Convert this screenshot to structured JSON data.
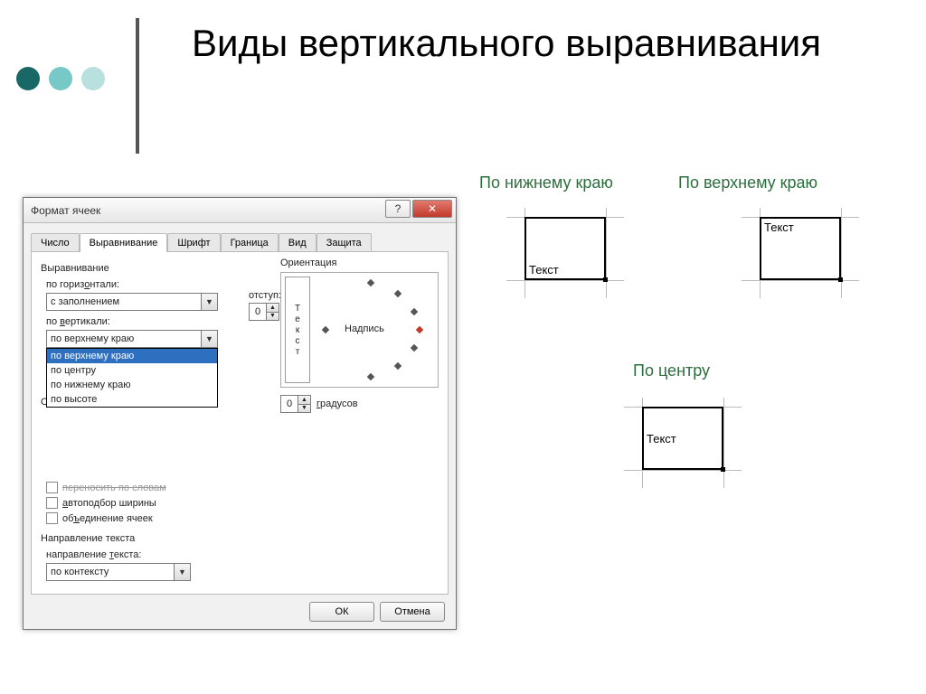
{
  "slide": {
    "title": "Виды вертикального выравнивания"
  },
  "dialog": {
    "title": "Формат ячеек",
    "help": "?",
    "close": "✕",
    "tabs": {
      "number": "Число",
      "alignment": "Выравнивание",
      "font": "Шрифт",
      "border": "Граница",
      "fill": "Вид",
      "protection": "Защита"
    },
    "align_group": "Выравнивание",
    "horiz_label": "по горизонтали:",
    "horiz_value": "с заполнением",
    "indent_label": "отступ:",
    "indent_value": "0",
    "vert_label": "по вертикали:",
    "vert_value": "по верхнему краю",
    "vert_options": {
      "top": "по верхнему краю",
      "center": "по центру",
      "bottom": "по нижнему краю",
      "justify": "по высоте"
    },
    "display_heading_prefix": "От",
    "checks": {
      "wrap_striked": "переносить по словам",
      "autofit": "автоподбор ширины",
      "merge": "объединение ячеек"
    },
    "text_dir_heading": "Направление текста",
    "text_dir_label": "направление текста:",
    "text_dir_value": "по контексту",
    "orient_heading": "Ориентация",
    "orient_vertical_chars": [
      "Т",
      "е",
      "к",
      "с",
      "т"
    ],
    "orient_dial_label": "Надпись",
    "degrees_value": "0",
    "degrees_label": "градусов",
    "ok": "ОК",
    "cancel": "Отмена"
  },
  "examples": {
    "bottom_label": "По нижнему краю",
    "top_label": "По верхнему краю",
    "center_label": "По центру",
    "cell_text": "Текст"
  }
}
